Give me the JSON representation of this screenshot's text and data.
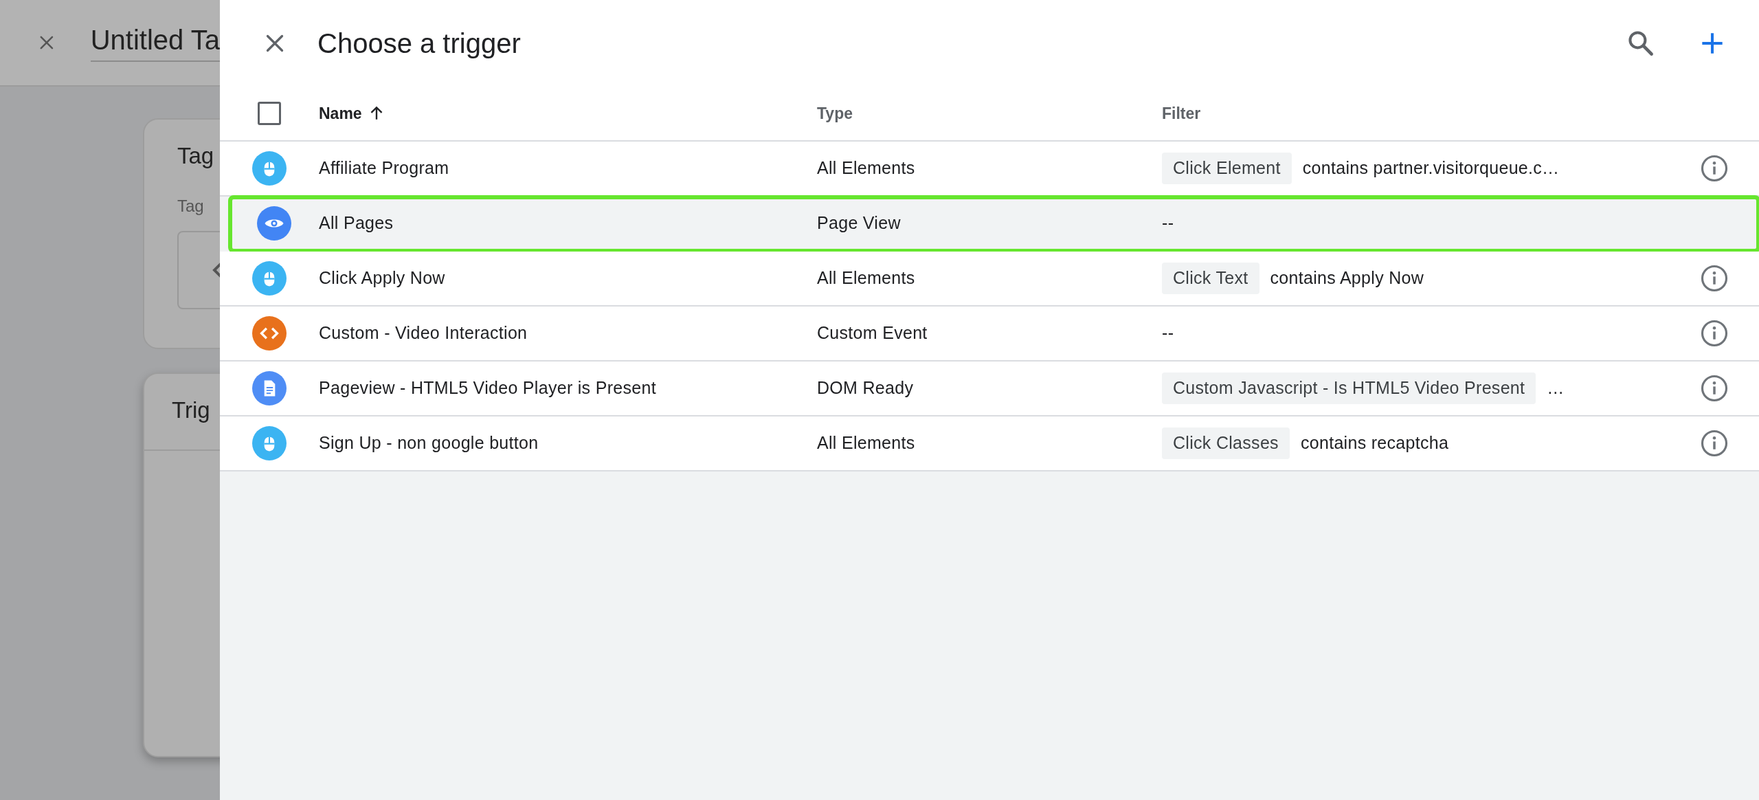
{
  "backdrop": {
    "title": "Untitled Ta",
    "cards": [
      {
        "title": "Tag",
        "field_label": "Tag"
      },
      {
        "title": "Trig"
      }
    ]
  },
  "dialog": {
    "title": "Choose a trigger"
  },
  "table": {
    "select_all_checked": false,
    "columns": [
      {
        "label": "Name",
        "sorted": true
      },
      {
        "label": "Type",
        "sorted": false
      },
      {
        "label": "Filter",
        "sorted": false
      }
    ],
    "rows": [
      {
        "kind": "click",
        "color": "#3bb4f2",
        "name": "Affiliate Program",
        "type": "All Elements",
        "filter_variable": "Click Element",
        "filter_condition": "contains partner.visitorqueue.c…",
        "selected": false,
        "highlighted": false,
        "info": true
      },
      {
        "kind": "pageview",
        "color": "#4285f4",
        "name": "All Pages",
        "type": "Page View",
        "filter_condition": "--",
        "selected": true,
        "highlighted": true,
        "info": false
      },
      {
        "kind": "click",
        "color": "#3bb4f2",
        "name": "Click Apply Now",
        "type": "All Elements",
        "filter_variable": "Click Text",
        "filter_condition": "contains Apply Now",
        "selected": false,
        "highlighted": false,
        "info": true
      },
      {
        "kind": "code",
        "color": "#e8711c",
        "name": "Custom - Video Interaction",
        "type": "Custom Event",
        "filter_condition": "--",
        "selected": false,
        "highlighted": false,
        "info": true
      },
      {
        "kind": "document",
        "color": "#4f8df5",
        "name": "Pageview - HTML5 Video Player is Present",
        "type": "DOM Ready",
        "filter_variable": "Custom Javascript - Is HTML5 Video Present",
        "filter_condition": "…",
        "selected": false,
        "highlighted": false,
        "info": true
      },
      {
        "kind": "click",
        "color": "#3bb4f2",
        "name": "Sign Up - non google button",
        "type": "All Elements",
        "filter_variable": "Click Classes",
        "filter_condition": "contains recaptcha",
        "selected": false,
        "highlighted": false,
        "info": true
      }
    ]
  }
}
